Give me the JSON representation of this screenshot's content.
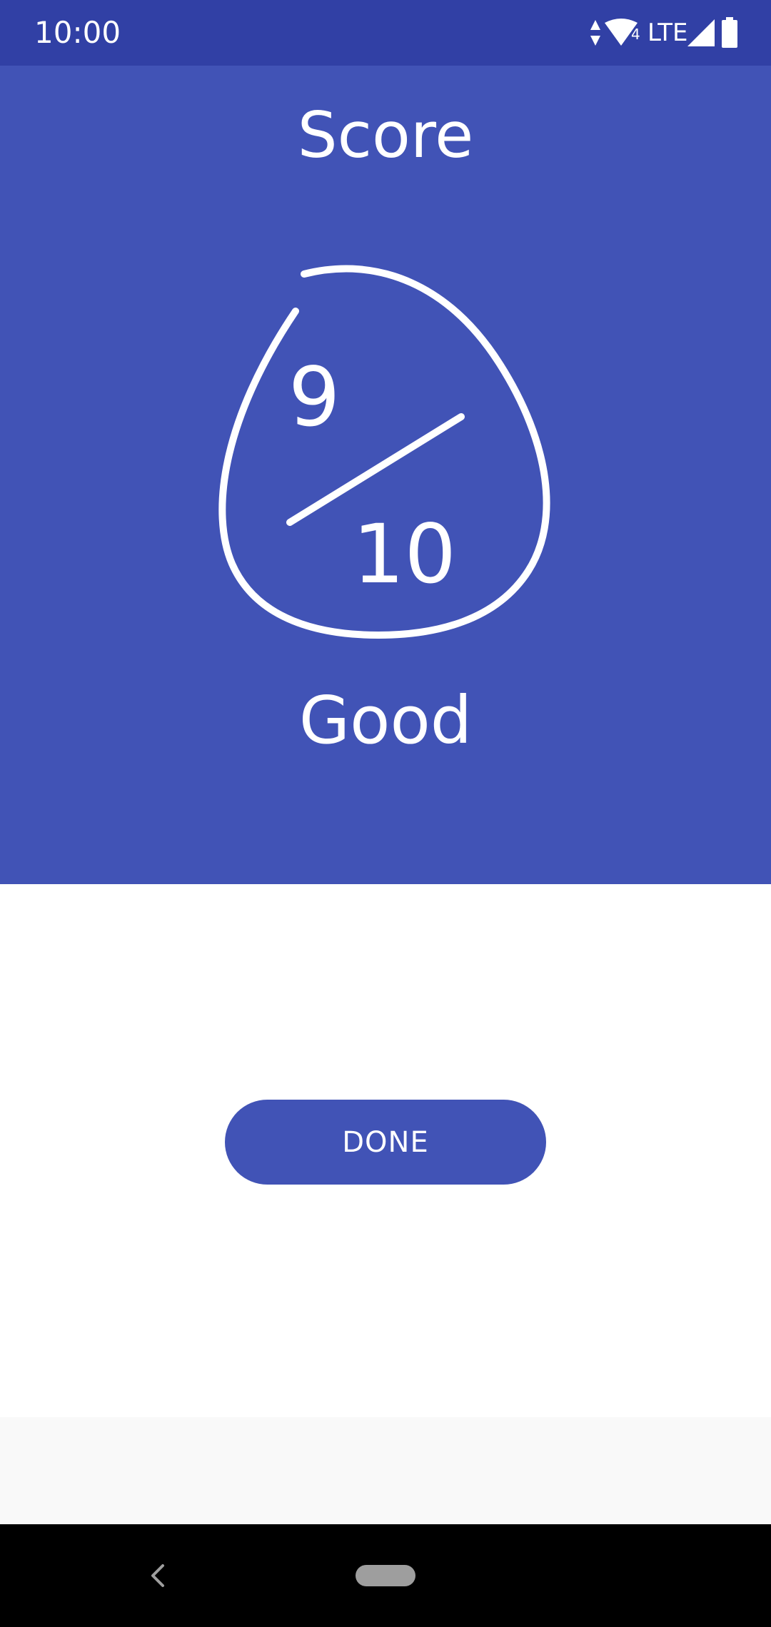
{
  "status_bar": {
    "time": "10:00",
    "network_label": "LTE",
    "icons": [
      "data-arrows-icon",
      "wifi-icon",
      "signal-icon",
      "battery-icon"
    ],
    "wifi_badge": "4"
  },
  "header": {
    "title": "Score",
    "score": "9",
    "total": "10",
    "rating": "Good"
  },
  "actions": {
    "done_label": "DONE"
  },
  "navigation": {
    "icons": [
      "back-icon",
      "home-pill-icon"
    ]
  },
  "colors": {
    "status_bar": "#3140a5",
    "primary": "#4153b6",
    "on_primary": "#ffffff",
    "surface": "#ffffff",
    "footer": "#f9f9f9",
    "nav_bar": "#000000"
  }
}
